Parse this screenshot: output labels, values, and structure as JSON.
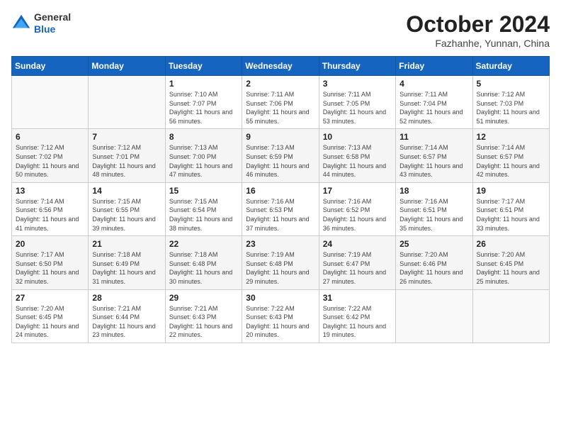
{
  "header": {
    "logo_general": "General",
    "logo_blue": "Blue",
    "month_title": "October 2024",
    "location": "Fazhanhe, Yunnan, China"
  },
  "weekdays": [
    "Sunday",
    "Monday",
    "Tuesday",
    "Wednesday",
    "Thursday",
    "Friday",
    "Saturday"
  ],
  "weeks": [
    [
      {
        "day": "",
        "sunrise": "",
        "sunset": "",
        "daylight": ""
      },
      {
        "day": "",
        "sunrise": "",
        "sunset": "",
        "daylight": ""
      },
      {
        "day": "1",
        "sunrise": "Sunrise: 7:10 AM",
        "sunset": "Sunset: 7:07 PM",
        "daylight": "Daylight: 11 hours and 56 minutes."
      },
      {
        "day": "2",
        "sunrise": "Sunrise: 7:11 AM",
        "sunset": "Sunset: 7:06 PM",
        "daylight": "Daylight: 11 hours and 55 minutes."
      },
      {
        "day": "3",
        "sunrise": "Sunrise: 7:11 AM",
        "sunset": "Sunset: 7:05 PM",
        "daylight": "Daylight: 11 hours and 53 minutes."
      },
      {
        "day": "4",
        "sunrise": "Sunrise: 7:11 AM",
        "sunset": "Sunset: 7:04 PM",
        "daylight": "Daylight: 11 hours and 52 minutes."
      },
      {
        "day": "5",
        "sunrise": "Sunrise: 7:12 AM",
        "sunset": "Sunset: 7:03 PM",
        "daylight": "Daylight: 11 hours and 51 minutes."
      }
    ],
    [
      {
        "day": "6",
        "sunrise": "Sunrise: 7:12 AM",
        "sunset": "Sunset: 7:02 PM",
        "daylight": "Daylight: 11 hours and 50 minutes."
      },
      {
        "day": "7",
        "sunrise": "Sunrise: 7:12 AM",
        "sunset": "Sunset: 7:01 PM",
        "daylight": "Daylight: 11 hours and 48 minutes."
      },
      {
        "day": "8",
        "sunrise": "Sunrise: 7:13 AM",
        "sunset": "Sunset: 7:00 PM",
        "daylight": "Daylight: 11 hours and 47 minutes."
      },
      {
        "day": "9",
        "sunrise": "Sunrise: 7:13 AM",
        "sunset": "Sunset: 6:59 PM",
        "daylight": "Daylight: 11 hours and 46 minutes."
      },
      {
        "day": "10",
        "sunrise": "Sunrise: 7:13 AM",
        "sunset": "Sunset: 6:58 PM",
        "daylight": "Daylight: 11 hours and 44 minutes."
      },
      {
        "day": "11",
        "sunrise": "Sunrise: 7:14 AM",
        "sunset": "Sunset: 6:57 PM",
        "daylight": "Daylight: 11 hours and 43 minutes."
      },
      {
        "day": "12",
        "sunrise": "Sunrise: 7:14 AM",
        "sunset": "Sunset: 6:57 PM",
        "daylight": "Daylight: 11 hours and 42 minutes."
      }
    ],
    [
      {
        "day": "13",
        "sunrise": "Sunrise: 7:14 AM",
        "sunset": "Sunset: 6:56 PM",
        "daylight": "Daylight: 11 hours and 41 minutes."
      },
      {
        "day": "14",
        "sunrise": "Sunrise: 7:15 AM",
        "sunset": "Sunset: 6:55 PM",
        "daylight": "Daylight: 11 hours and 39 minutes."
      },
      {
        "day": "15",
        "sunrise": "Sunrise: 7:15 AM",
        "sunset": "Sunset: 6:54 PM",
        "daylight": "Daylight: 11 hours and 38 minutes."
      },
      {
        "day": "16",
        "sunrise": "Sunrise: 7:16 AM",
        "sunset": "Sunset: 6:53 PM",
        "daylight": "Daylight: 11 hours and 37 minutes."
      },
      {
        "day": "17",
        "sunrise": "Sunrise: 7:16 AM",
        "sunset": "Sunset: 6:52 PM",
        "daylight": "Daylight: 11 hours and 36 minutes."
      },
      {
        "day": "18",
        "sunrise": "Sunrise: 7:16 AM",
        "sunset": "Sunset: 6:51 PM",
        "daylight": "Daylight: 11 hours and 35 minutes."
      },
      {
        "day": "19",
        "sunrise": "Sunrise: 7:17 AM",
        "sunset": "Sunset: 6:51 PM",
        "daylight": "Daylight: 11 hours and 33 minutes."
      }
    ],
    [
      {
        "day": "20",
        "sunrise": "Sunrise: 7:17 AM",
        "sunset": "Sunset: 6:50 PM",
        "daylight": "Daylight: 11 hours and 32 minutes."
      },
      {
        "day": "21",
        "sunrise": "Sunrise: 7:18 AM",
        "sunset": "Sunset: 6:49 PM",
        "daylight": "Daylight: 11 hours and 31 minutes."
      },
      {
        "day": "22",
        "sunrise": "Sunrise: 7:18 AM",
        "sunset": "Sunset: 6:48 PM",
        "daylight": "Daylight: 11 hours and 30 minutes."
      },
      {
        "day": "23",
        "sunrise": "Sunrise: 7:19 AM",
        "sunset": "Sunset: 6:48 PM",
        "daylight": "Daylight: 11 hours and 29 minutes."
      },
      {
        "day": "24",
        "sunrise": "Sunrise: 7:19 AM",
        "sunset": "Sunset: 6:47 PM",
        "daylight": "Daylight: 11 hours and 27 minutes."
      },
      {
        "day": "25",
        "sunrise": "Sunrise: 7:20 AM",
        "sunset": "Sunset: 6:46 PM",
        "daylight": "Daylight: 11 hours and 26 minutes."
      },
      {
        "day": "26",
        "sunrise": "Sunrise: 7:20 AM",
        "sunset": "Sunset: 6:45 PM",
        "daylight": "Daylight: 11 hours and 25 minutes."
      }
    ],
    [
      {
        "day": "27",
        "sunrise": "Sunrise: 7:20 AM",
        "sunset": "Sunset: 6:45 PM",
        "daylight": "Daylight: 11 hours and 24 minutes."
      },
      {
        "day": "28",
        "sunrise": "Sunrise: 7:21 AM",
        "sunset": "Sunset: 6:44 PM",
        "daylight": "Daylight: 11 hours and 23 minutes."
      },
      {
        "day": "29",
        "sunrise": "Sunrise: 7:21 AM",
        "sunset": "Sunset: 6:43 PM",
        "daylight": "Daylight: 11 hours and 22 minutes."
      },
      {
        "day": "30",
        "sunrise": "Sunrise: 7:22 AM",
        "sunset": "Sunset: 6:43 PM",
        "daylight": "Daylight: 11 hours and 20 minutes."
      },
      {
        "day": "31",
        "sunrise": "Sunrise: 7:22 AM",
        "sunset": "Sunset: 6:42 PM",
        "daylight": "Daylight: 11 hours and 19 minutes."
      },
      {
        "day": "",
        "sunrise": "",
        "sunset": "",
        "daylight": ""
      },
      {
        "day": "",
        "sunrise": "",
        "sunset": "",
        "daylight": ""
      }
    ]
  ]
}
